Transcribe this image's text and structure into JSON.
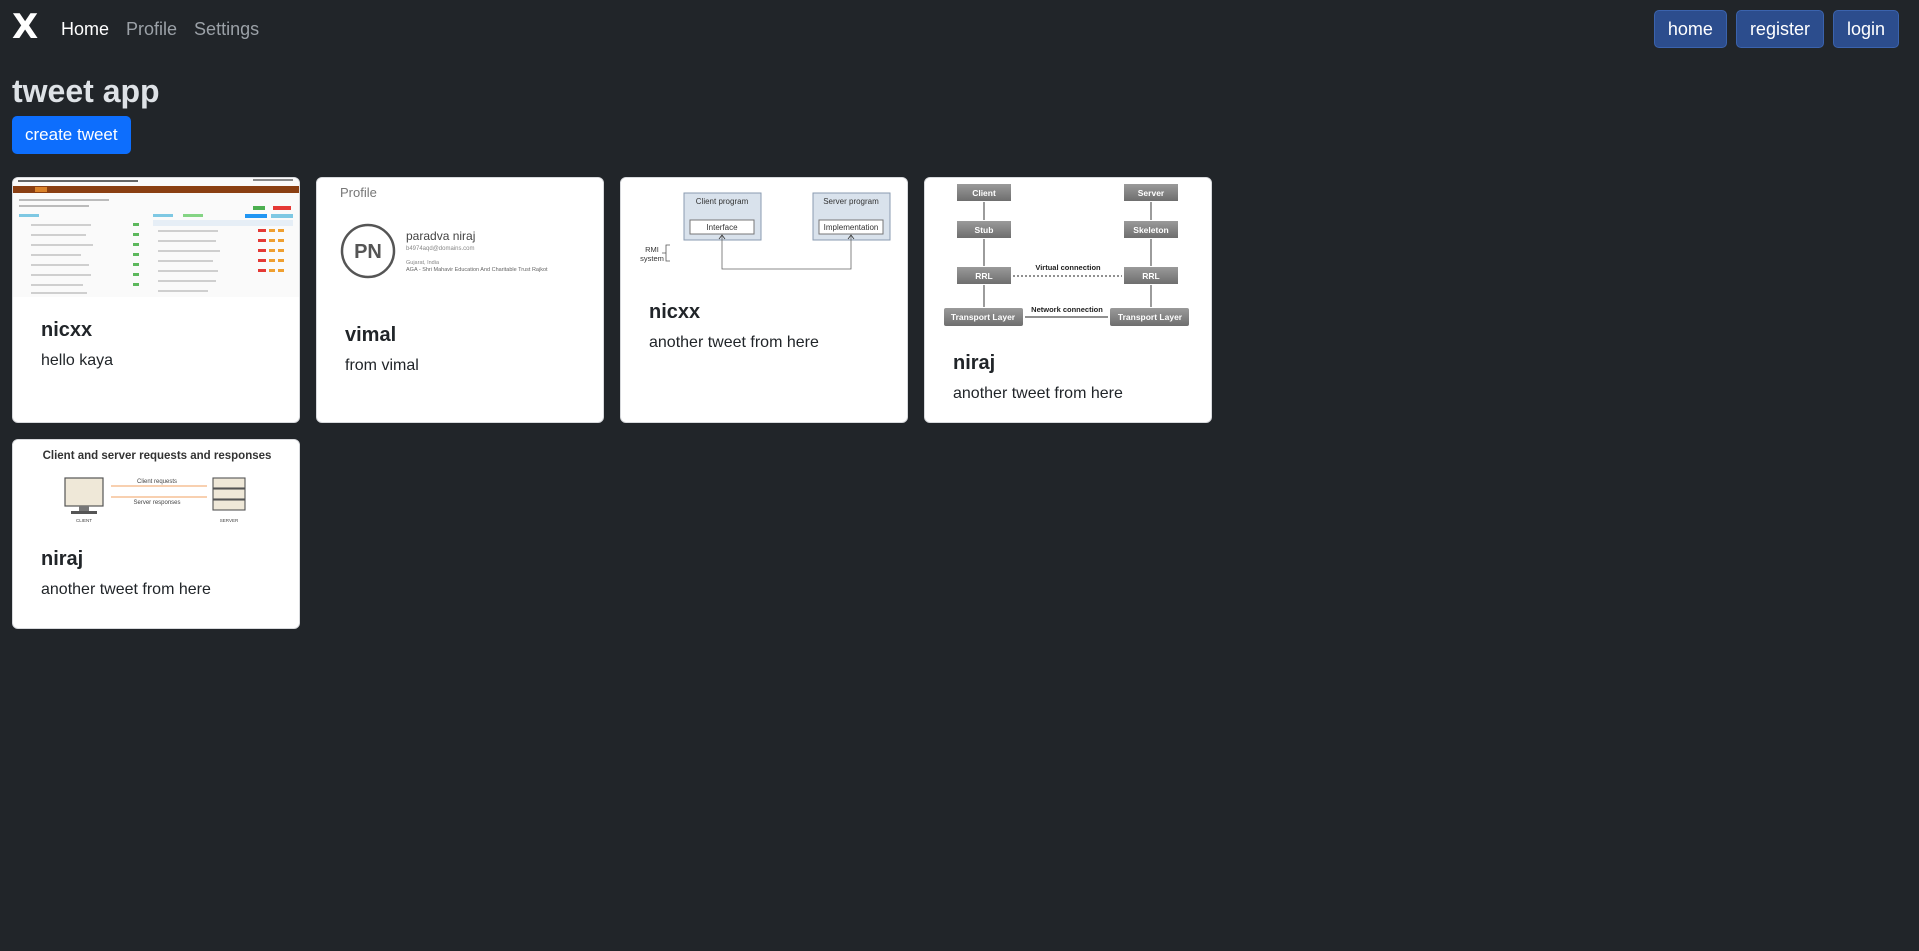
{
  "nav": {
    "brand": "X",
    "links": [
      "Home",
      "Profile",
      "Settings"
    ],
    "buttons": [
      "home",
      "register",
      "login"
    ]
  },
  "page": {
    "title": "tweet app",
    "create_button": "create tweet"
  },
  "tweets": [
    {
      "user": "nicxx",
      "text": "hello kaya",
      "image": "spreadsheet-screenshot"
    },
    {
      "user": "vimal",
      "text": "from vimal",
      "image": "profile-screenshot",
      "image_text": {
        "header": "Profile",
        "initials": "PN",
        "name": "paradva niraj",
        "email": "b4974aqd@domains.com",
        "location": "Gujarat, India",
        "org": "AGA - Shri Mahavir Education And Charitable Trust Rajkot"
      }
    },
    {
      "user": "nicxx",
      "text": "another tweet from here",
      "image": "rmi-diagram",
      "image_text": {
        "client": "Client program",
        "server": "Server program",
        "interface": "Interface",
        "impl": "Implementation",
        "rmi": "RMI",
        "system": "system"
      }
    },
    {
      "user": "niraj",
      "text": "another tweet from here",
      "image": "rmi-architecture-diagram",
      "image_text": {
        "client": "Client",
        "server": "Server",
        "stub": "Stub",
        "skeleton": "Skeleton",
        "rrl": "RRL",
        "virtual": "Virtual connection",
        "network": "Network connection",
        "transport": "Transport Layer"
      }
    },
    {
      "user": "niraj",
      "text": "another tweet from here",
      "image": "client-server-diagram",
      "image_text": {
        "title": "Client and server requests and responses",
        "requests": "Client requests",
        "responses": "Server responses",
        "client": "CLIENT",
        "server": "SERVER"
      }
    }
  ],
  "colors": {
    "background": "#212529",
    "primary": "#0d6efd",
    "nav_button": "#2c4d8d",
    "card": "#ffffff"
  }
}
